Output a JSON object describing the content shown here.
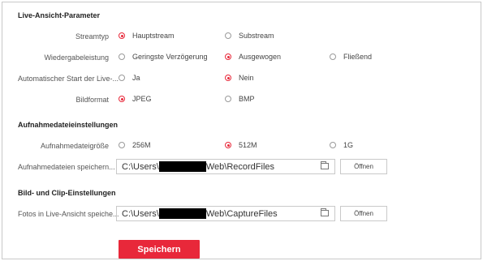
{
  "live": {
    "section_title": "Live-Ansicht-Parameter",
    "stream_label": "Streamtyp",
    "stream_options": [
      "Hauptstream",
      "Substream"
    ],
    "playback_label": "Wiedergabeleistung",
    "playback_options": [
      "Geringste Verzögerung",
      "Ausgewogen",
      "Fließend"
    ],
    "autostart_label": "Automatischer Start der Live-...",
    "autostart_options": [
      "Ja",
      "Nein"
    ],
    "format_label": "Bildformat",
    "format_options": [
      "JPEG",
      "BMP"
    ]
  },
  "record": {
    "section_title": "Aufnahmedateieinstellungen",
    "size_label": "Aufnahmedateigröße",
    "size_options": [
      "256M",
      "512M",
      "1G"
    ],
    "save_label": "Aufnahmedateien speichern...",
    "path_prefix": "C:\\Users\\",
    "path_suffix": "Web\\RecordFiles",
    "open_label": "Öffnen"
  },
  "capture": {
    "section_title": "Bild- und Clip-Einstellungen",
    "save_label": "Fotos in Live-Ansicht speiche...",
    "path_prefix": "C:\\Users\\",
    "path_suffix": "Web\\CaptureFiles",
    "open_label": "Öffnen"
  },
  "footer": {
    "save_button": "Speichern"
  },
  "selected": {
    "stream": "Hauptstream",
    "playback": "Ausgewogen",
    "autostart": "Nein",
    "format": "JPEG",
    "size": "512M"
  },
  "colors": {
    "accent": "#e8283a"
  }
}
